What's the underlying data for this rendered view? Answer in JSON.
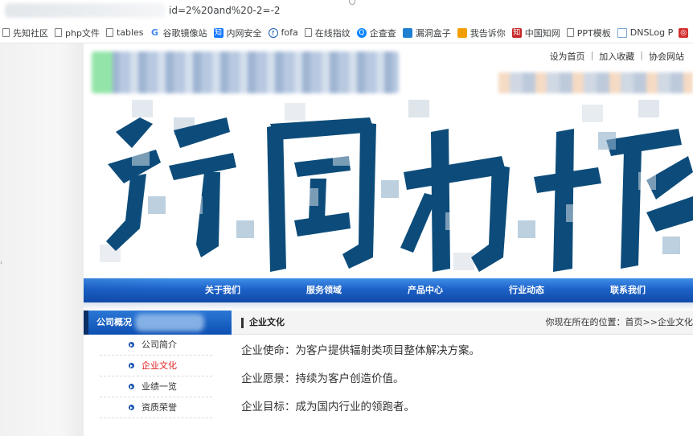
{
  "browser": {
    "url_visible": "id=2%20and%20-2=-2",
    "bookmarks": [
      {
        "label": "先知社区",
        "icon": "page-icon"
      },
      {
        "label": "php文件",
        "icon": "page-icon"
      },
      {
        "label": "tables",
        "icon": "tool-icon"
      },
      {
        "label": "谷歌镜像站",
        "icon": "google-icon"
      },
      {
        "label": "内网安全",
        "icon": "zhihu-icon"
      },
      {
        "label": "fofa",
        "icon": "fofa-icon"
      },
      {
        "label": "在线指纹",
        "icon": "page-icon"
      },
      {
        "label": "企查查",
        "icon": "qcc-icon"
      },
      {
        "label": "漏洞盒子",
        "icon": "cloud-icon"
      },
      {
        "label": "我告诉你",
        "icon": "orange-icon"
      },
      {
        "label": "中国知网",
        "icon": "cnki-icon"
      },
      {
        "label": "PPT模板",
        "icon": "page-icon"
      },
      {
        "label": "DNSLog P",
        "icon": "dns-icon"
      }
    ]
  },
  "header": {
    "toplinks": [
      "设为首页",
      "加入收藏",
      "协会网站"
    ]
  },
  "nav": {
    "items": [
      "关于我们",
      "服务领域",
      "产品中心",
      "行业动态",
      "联系我们"
    ]
  },
  "sidebar": {
    "title": "公司概况",
    "items": [
      {
        "label": "公司简介",
        "active": false
      },
      {
        "label": "企业文化",
        "active": true
      },
      {
        "label": "业绩一览",
        "active": false
      },
      {
        "label": "资质荣誉",
        "active": false
      }
    ]
  },
  "content": {
    "title": "企业文化",
    "breadcrumb": "你现在所在的位置：首页>>企业文化",
    "paragraphs": [
      "企业使命：为客户提供辐射类项目整体解决方案。",
      "企业愿景：持续为客户创造价值。",
      "企业目标：成为国内行业的领跑者。"
    ]
  },
  "colors": {
    "nav_top": "#3f8ee8",
    "nav_bottom": "#0f4aa8",
    "calligraphy": "#0d4c7a",
    "active_link": "#e02020"
  }
}
